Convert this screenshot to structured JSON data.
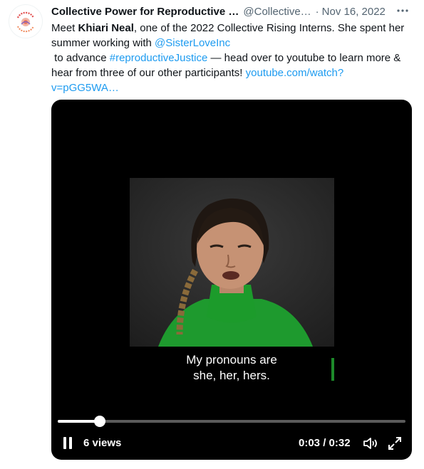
{
  "tweet": {
    "author_name": "Collective Power for Reproductive …",
    "handle": "@Collective…",
    "separator": "·",
    "date": "Nov 16, 2022",
    "more_icon": "more-horizontal-icon",
    "avatar_text": "COLLECTIVE POWER",
    "text": {
      "l1_a": "Meet ",
      "l1_b": "Khiari Neal",
      "l1_c": ", one of the 2022 Collective Rising Interns. She spent her",
      "l2_a": "summer working with ",
      "l2_mention": "@SisterLoveInc",
      "l3_a": " to advance ",
      "l3_hashtag": "#reproductiveJustice",
      "l3_b": " — head over to youtube to learn more &",
      "l4_a": "hear from three of our other participants! ",
      "l4_link": "youtube.com/watch?",
      "l5_link": "v=pGG5WA…"
    }
  },
  "video": {
    "caption_line1": "My pronouns are",
    "caption_line2": "she, her, hers.",
    "progress": 0.12,
    "views": "6 views",
    "current_time": "0:03",
    "duration": "0:32",
    "time_separator": " / ",
    "icons": [
      "pause-icon",
      "volume-icon",
      "fullscreen-icon"
    ]
  },
  "colors": {
    "link": "#1d9bf0",
    "secondary_text": "#536471",
    "shirt_green": "#1e9a2e"
  }
}
